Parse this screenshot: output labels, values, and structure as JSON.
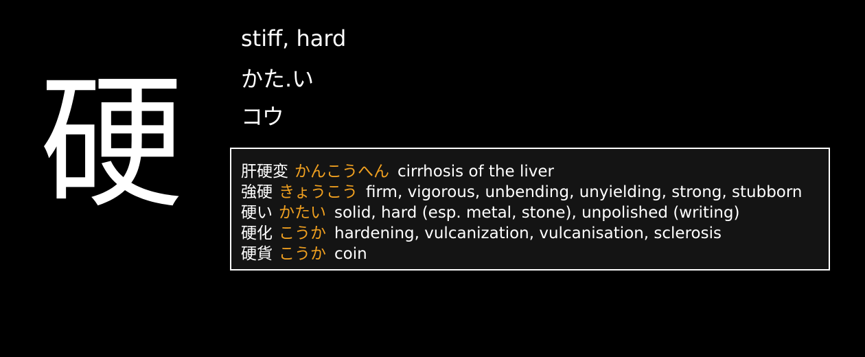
{
  "kanji": "硬",
  "meaning": "stiff, hard",
  "kun_reading": "かた.い",
  "on_reading": "コウ",
  "colors": {
    "background": "#000000",
    "text": "#ffffff",
    "reading_accent": "#f0a020",
    "box_background": "#141414",
    "box_border": "#ffffff"
  },
  "vocabulary": [
    {
      "word": "肝硬変",
      "reading": "かんこうへん",
      "gloss": "cirrhosis of the liver"
    },
    {
      "word": "強硬",
      "reading": "きょうこう",
      "gloss": "firm, vigorous, unbending, unyielding, strong, stubborn"
    },
    {
      "word": "硬い",
      "reading": "かたい",
      "gloss": "solid, hard (esp. metal, stone), unpolished (writing)"
    },
    {
      "word": "硬化",
      "reading": "こうか",
      "gloss": "hardening, vulcanization, vulcanisation, sclerosis"
    },
    {
      "word": "硬貨",
      "reading": "こうか",
      "gloss": "coin"
    }
  ]
}
